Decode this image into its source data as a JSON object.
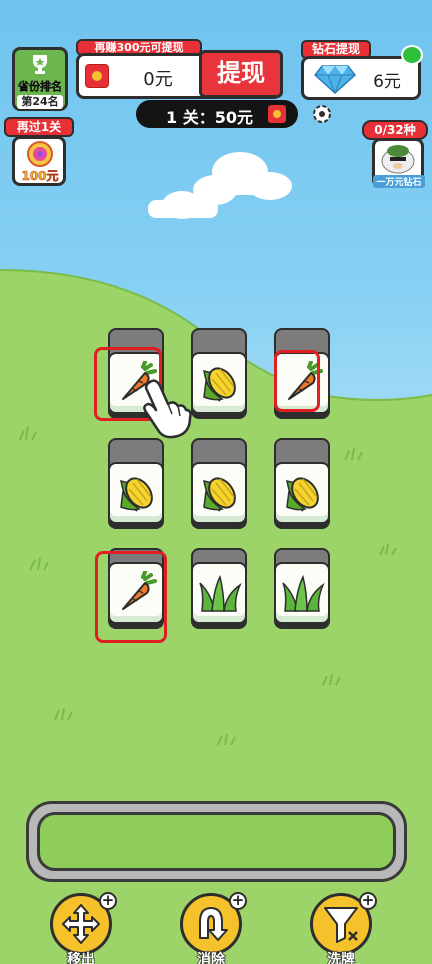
{
  "top": {
    "rank_label": "省份排名",
    "rank_value": "第24名",
    "earn_tip": "再赚300元可提现",
    "money": "0元",
    "withdraw_label": "提现",
    "diamond_tag": "钻石提现",
    "diamond_amount": "6元",
    "level_text": "1 关：50元"
  },
  "left_badge": {
    "tag": "再过1关",
    "prize": "100元"
  },
  "right_badge": {
    "tag": "0/32种",
    "label": "一万元钻石"
  },
  "tools": [
    {
      "label": "移出",
      "icon": "move-out-icon"
    },
    {
      "label": "消除",
      "icon": "undo-icon"
    },
    {
      "label": "洗牌",
      "icon": "shuffle-filter-icon"
    }
  ],
  "tiles": [
    {
      "item": "carrot"
    },
    {
      "item": "corn"
    },
    {
      "item": "carrot"
    },
    {
      "item": "corn"
    },
    {
      "item": "corn"
    },
    {
      "item": "corn"
    },
    {
      "item": "carrot"
    },
    {
      "item": "grass"
    },
    {
      "item": "grass"
    }
  ],
  "colors": {
    "sky": "#7cc8ef",
    "grass": "#9cd469",
    "accent_red": "#e83037",
    "gold": "#f5c22c"
  }
}
